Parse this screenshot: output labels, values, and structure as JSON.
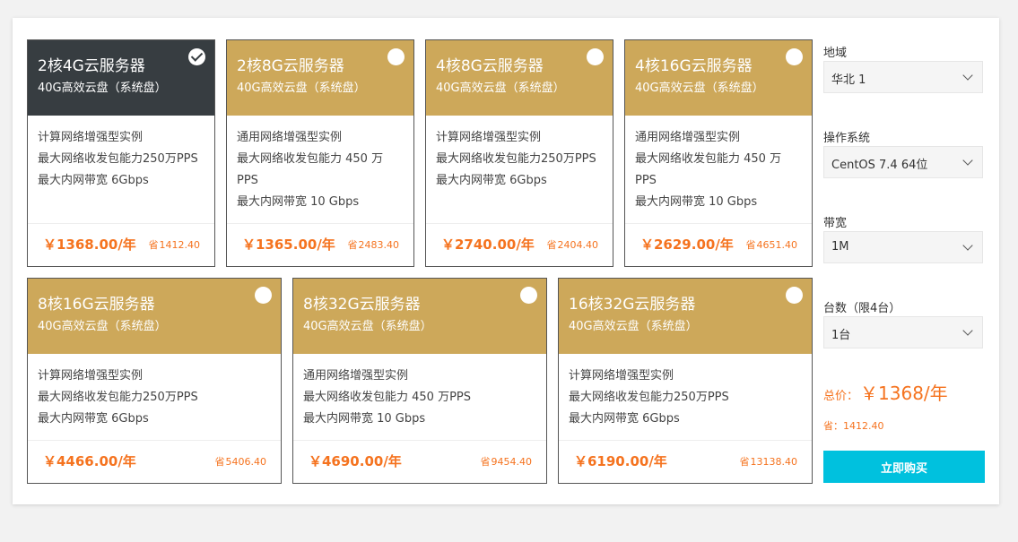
{
  "cards": [
    {
      "title": "2核4G云服务器",
      "subtitle": "40G高效云盘（系统盘）",
      "lines": [
        "计算网络增强型实例",
        "最大网络收发包能力250万PPS",
        "最大内网带宽 6Gbps"
      ],
      "price": "￥1368.00/年",
      "save": "1412.40",
      "selected": true
    },
    {
      "title": "2核8G云服务器",
      "subtitle": "40G高效云盘（系统盘）",
      "lines": [
        "通用网络增强型实例",
        "最大网络收发包能力 450 万PPS",
        "最大内网带宽 10 Gbps"
      ],
      "price": "￥1365.00/年",
      "save": "2483.40",
      "selected": false
    },
    {
      "title": "4核8G云服务器",
      "subtitle": "40G高效云盘（系统盘）",
      "lines": [
        "计算网络增强型实例",
        "最大网络收发包能力250万PPS",
        "最大内网带宽 6Gbps"
      ],
      "price": "￥2740.00/年",
      "save": "2404.40",
      "selected": false
    },
    {
      "title": "4核16G云服务器",
      "subtitle": "40G高效云盘（系统盘）",
      "lines": [
        "通用网络增强型实例",
        "最大网络收发包能力 450 万PPS",
        "最大内网带宽 10 Gbps"
      ],
      "price": "￥2629.00/年",
      "save": "4651.40",
      "selected": false
    },
    {
      "title": "8核16G云服务器",
      "subtitle": "40G高效云盘（系统盘）",
      "lines": [
        "计算网络增强型实例",
        "最大网络收发包能力250万PPS",
        "最大内网带宽 6Gbps"
      ],
      "price": "￥4466.00/年",
      "save": "5406.40",
      "selected": false
    },
    {
      "title": "8核32G云服务器",
      "subtitle": "40G高效云盘（系统盘）",
      "lines": [
        "通用网络增强型实例",
        "最大网络收发包能力 450 万PPS",
        "最大内网带宽 10 Gbps"
      ],
      "price": "￥4690.00/年",
      "save": "9454.40",
      "selected": false
    },
    {
      "title": "16核32G云服务器",
      "subtitle": "40G高效云盘（系统盘）",
      "lines": [
        "计算网络增强型实例",
        "最大网络收发包能力250万PPS",
        "最大内网带宽 6Gbps"
      ],
      "price": "￥6190.00/年",
      "save": "13138.40",
      "selected": false
    }
  ],
  "save_icon": "省",
  "sidebar": {
    "region": {
      "label": "地域",
      "value": "华北 1"
    },
    "os": {
      "label": "操作系统",
      "value": "CentOS 7.4 64位"
    },
    "bandwidth": {
      "label": "带宽",
      "value": "1M"
    },
    "count": {
      "label": "台数（限4台）",
      "value": "1台"
    },
    "total_label": "总价：",
    "total_value": "￥1368/年",
    "total_save": "省：1412.40",
    "buy_label": "立即购买"
  },
  "colors": {
    "card_gold": "#cda85a",
    "card_selected": "#373d41",
    "price_orange": "#f5731f",
    "buy_cyan": "#00c1de"
  }
}
